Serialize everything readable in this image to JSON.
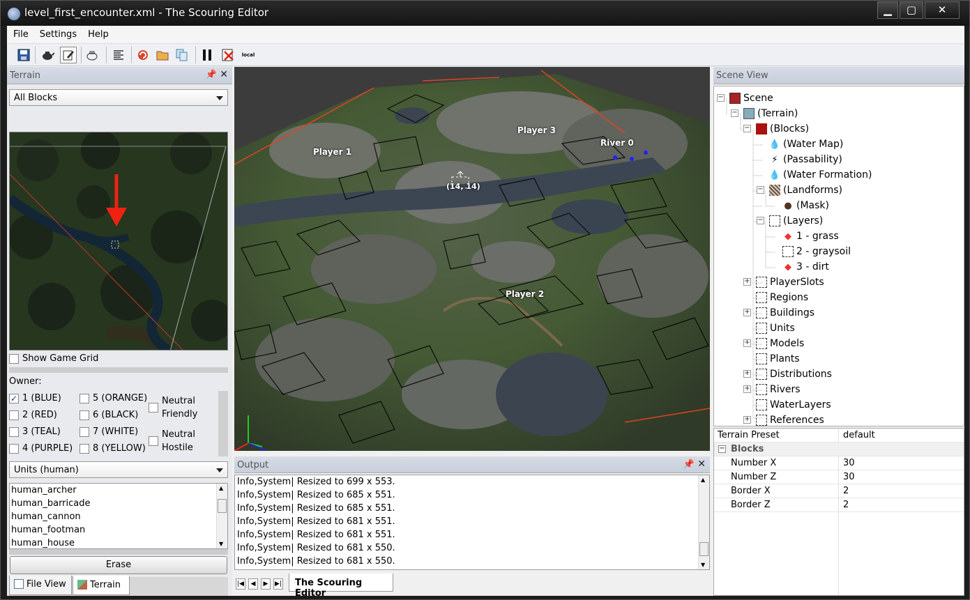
{
  "window": {
    "title": "level_first_encounter.xml - The Scouring Editor",
    "minimize": "▁",
    "maximize": "▢",
    "close": "✕"
  },
  "menu": [
    "File",
    "Settings",
    "Help"
  ],
  "toolbar": {
    "local_label": "local"
  },
  "terrain_panel": {
    "title": "Terrain",
    "block_filter": "All Blocks",
    "show_game_grid": "Show Game Grid",
    "owner_label": "Owner:",
    "owners": [
      "1 (BLUE)",
      "2 (RED)",
      "3 (TEAL)",
      "4 (PURPLE)",
      "5 (ORANGE)",
      "6 (BLACK)",
      "7 (WHITE)",
      "8 (YELLOW)"
    ],
    "neutral_friendly": [
      "Neutral",
      "Friendly"
    ],
    "neutral_hostile": [
      "Neutral",
      "Hostile"
    ],
    "unit_filter": "Units (human)",
    "units": [
      "human_archer",
      "human_barricade",
      "human_cannon",
      "human_footman",
      "human_house"
    ],
    "erase": "Erase"
  },
  "left_tabs": [
    "File View",
    "Terrain"
  ],
  "viewport": {
    "labels": [
      "Player 1",
      "Player 3",
      "River 0",
      "Player 2"
    ],
    "cursor": "(14, 14)"
  },
  "output": {
    "title": "Output",
    "lines": [
      "Info,System| Resized to 699 x 553.",
      "Info,System| Resized to 685 x 551.",
      "Info,System| Resized to 685 x 551.",
      "Info,System| Resized to 681 x 551.",
      "Info,System| Resized to 681 x 551.",
      "Info,System| Resized to 681 x 550.",
      "Info,System| Resized to 681 x 550."
    ],
    "tab": "The Scouring Editor"
  },
  "scene": {
    "title": "Scene View",
    "nodes": [
      "Scene",
      "(Terrain)",
      "(Blocks)",
      "(Water Map)",
      "(Passability)",
      "(Water Formation)",
      "(Landforms)",
      "(Mask)",
      "(Layers)",
      "1 - grass",
      "2 - graysoil",
      "3 - dirt",
      "PlayerSlots",
      "Regions",
      "Buildings",
      "Units",
      "Models",
      "Plants",
      "Distributions",
      "Rivers",
      "WaterLayers",
      "References"
    ]
  },
  "properties": {
    "preset_key": "Terrain Preset",
    "preset_value": "default",
    "group": "Blocks",
    "rows": [
      {
        "key": "Number X",
        "value": "30"
      },
      {
        "key": "Number Z",
        "value": "30"
      },
      {
        "key": "Border X",
        "value": "2"
      },
      {
        "key": "Border Z",
        "value": "2"
      }
    ]
  }
}
